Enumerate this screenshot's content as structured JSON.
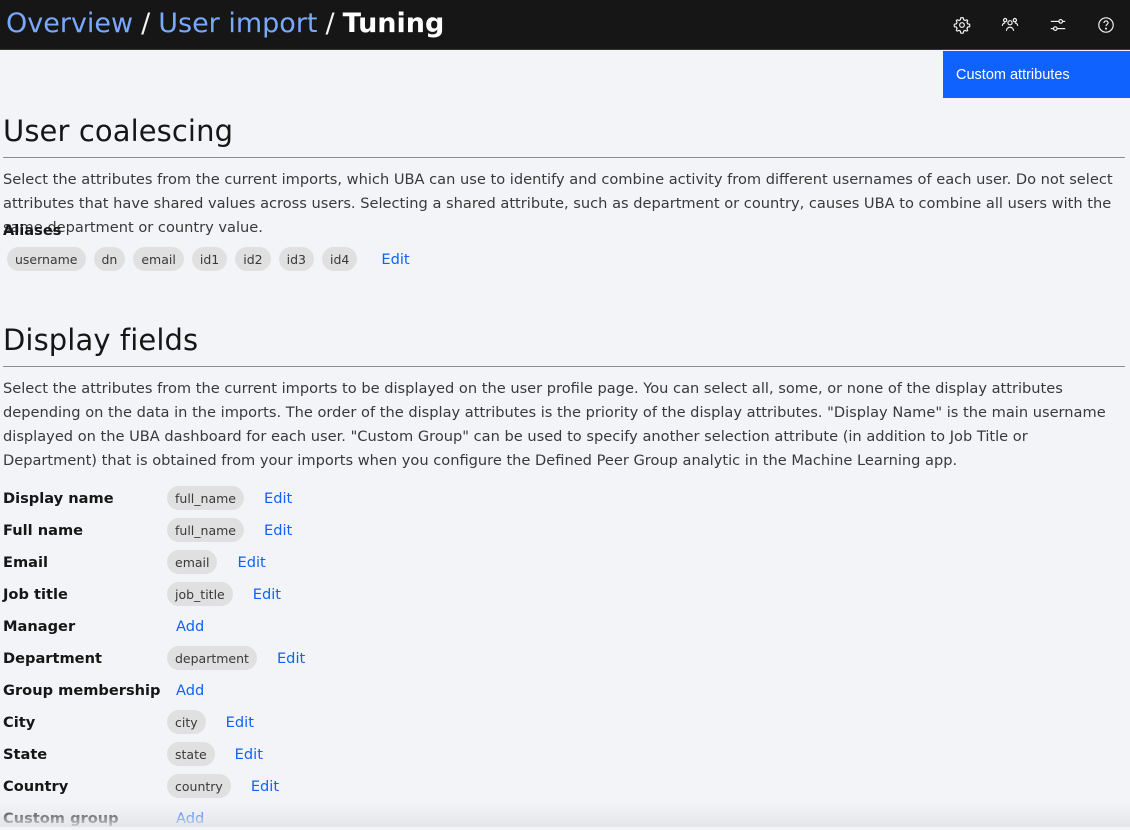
{
  "header": {
    "breadcrumb": [
      {
        "label": "Overview"
      },
      {
        "label": "User import"
      }
    ],
    "current": "Tuning",
    "separator": "/",
    "icons": [
      "settings-icon",
      "users-icon",
      "sliders-icon",
      "help-icon"
    ]
  },
  "custom_attributes_button": "Custom attributes",
  "coalescing": {
    "title": "User coalescing",
    "description": "Select the attributes from the current imports, which UBA can use to identify and combine activity from different usernames of each user. Do not select attributes that have shared values across users. Selecting a shared attribute, such as department or country, causes UBA to combine all users with the same department or country value.",
    "aliases_label": "Aliases",
    "aliases": [
      "username",
      "dn",
      "email",
      "id1",
      "id2",
      "id3",
      "id4"
    ],
    "edit_label": "Edit"
  },
  "display_fields": {
    "title": "Display fields",
    "description": "Select the attributes from the current imports to be displayed on the user profile page. You can select all, some, or none of the display attributes depending on the data in the imports. The order of the display attributes is the priority of the display attributes. \"Display Name\" is the main username displayed on the UBA dashboard for each user. \"Custom Group\" can be used to specify another selection attribute (in addition to Job Title or Department) that is obtained from your imports when you configure the Defined Peer Group analytic in the Machine Learning app.",
    "fields": [
      {
        "label": "Display name",
        "value": "full_name",
        "action": "Edit"
      },
      {
        "label": "Full name",
        "value": "full_name",
        "action": "Edit"
      },
      {
        "label": "Email",
        "value": "email",
        "action": "Edit"
      },
      {
        "label": "Job title",
        "value": "job_title",
        "action": "Edit"
      },
      {
        "label": "Manager",
        "value": null,
        "action": "Add"
      },
      {
        "label": "Department",
        "value": "department",
        "action": "Edit"
      },
      {
        "label": "Group membership",
        "value": null,
        "action": "Add"
      },
      {
        "label": "City",
        "value": "city",
        "action": "Edit"
      },
      {
        "label": "State",
        "value": "state",
        "action": "Edit"
      },
      {
        "label": "Country",
        "value": "country",
        "action": "Edit"
      },
      {
        "label": "Custom group",
        "value": null,
        "action": "Add"
      }
    ]
  },
  "colors": {
    "topbar": "#161616",
    "link": "#0f62fe",
    "breadcrumb_link": "#78a9ff",
    "primary_button": "#0f62fe",
    "tag_bg": "#e0e0e0",
    "page_bg": "#f2f4f8"
  }
}
